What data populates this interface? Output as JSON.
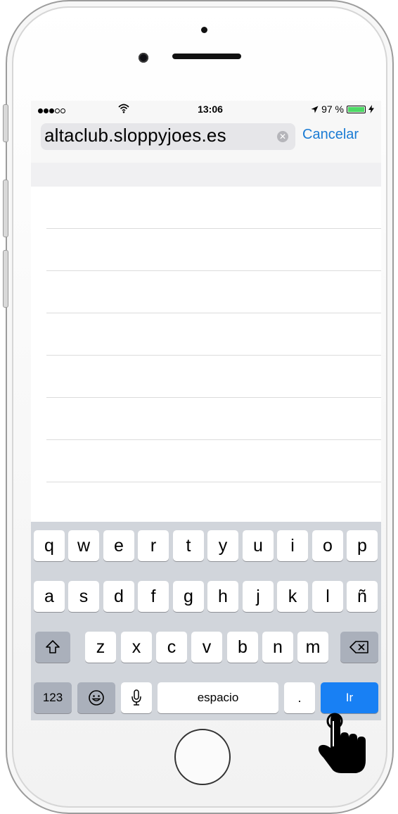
{
  "status_bar": {
    "time": "13:06",
    "battery": "97 %",
    "signal_filled": 3,
    "signal_total": 5
  },
  "url_bar": {
    "url": "altaclub.sloppyjoes.es",
    "cancel_label": "Cancelar"
  },
  "keyboard": {
    "row1": [
      "q",
      "w",
      "e",
      "r",
      "t",
      "y",
      "u",
      "i",
      "o",
      "p"
    ],
    "row2": [
      "a",
      "s",
      "d",
      "f",
      "g",
      "h",
      "j",
      "k",
      "l",
      "ñ"
    ],
    "row3": [
      "z",
      "x",
      "c",
      "v",
      "b",
      "n",
      "m"
    ],
    "numbers_label": "123",
    "space_label": "espacio",
    "period_label": ".",
    "go_label": "Ir"
  },
  "colors": {
    "accent": "#1a7bd4",
    "go_key": "#1880f4",
    "keyboard_bg": "#d1d5db",
    "battery_fill": "#4cd964"
  },
  "icons": {
    "wifi": "wifi-icon",
    "location": "location-arrow-icon",
    "shift": "shift-icon",
    "backspace": "backspace-icon",
    "emoji": "emoji-icon",
    "mic": "microphone-icon",
    "clear": "clear-icon",
    "pointer": "hand-pointer-icon"
  }
}
